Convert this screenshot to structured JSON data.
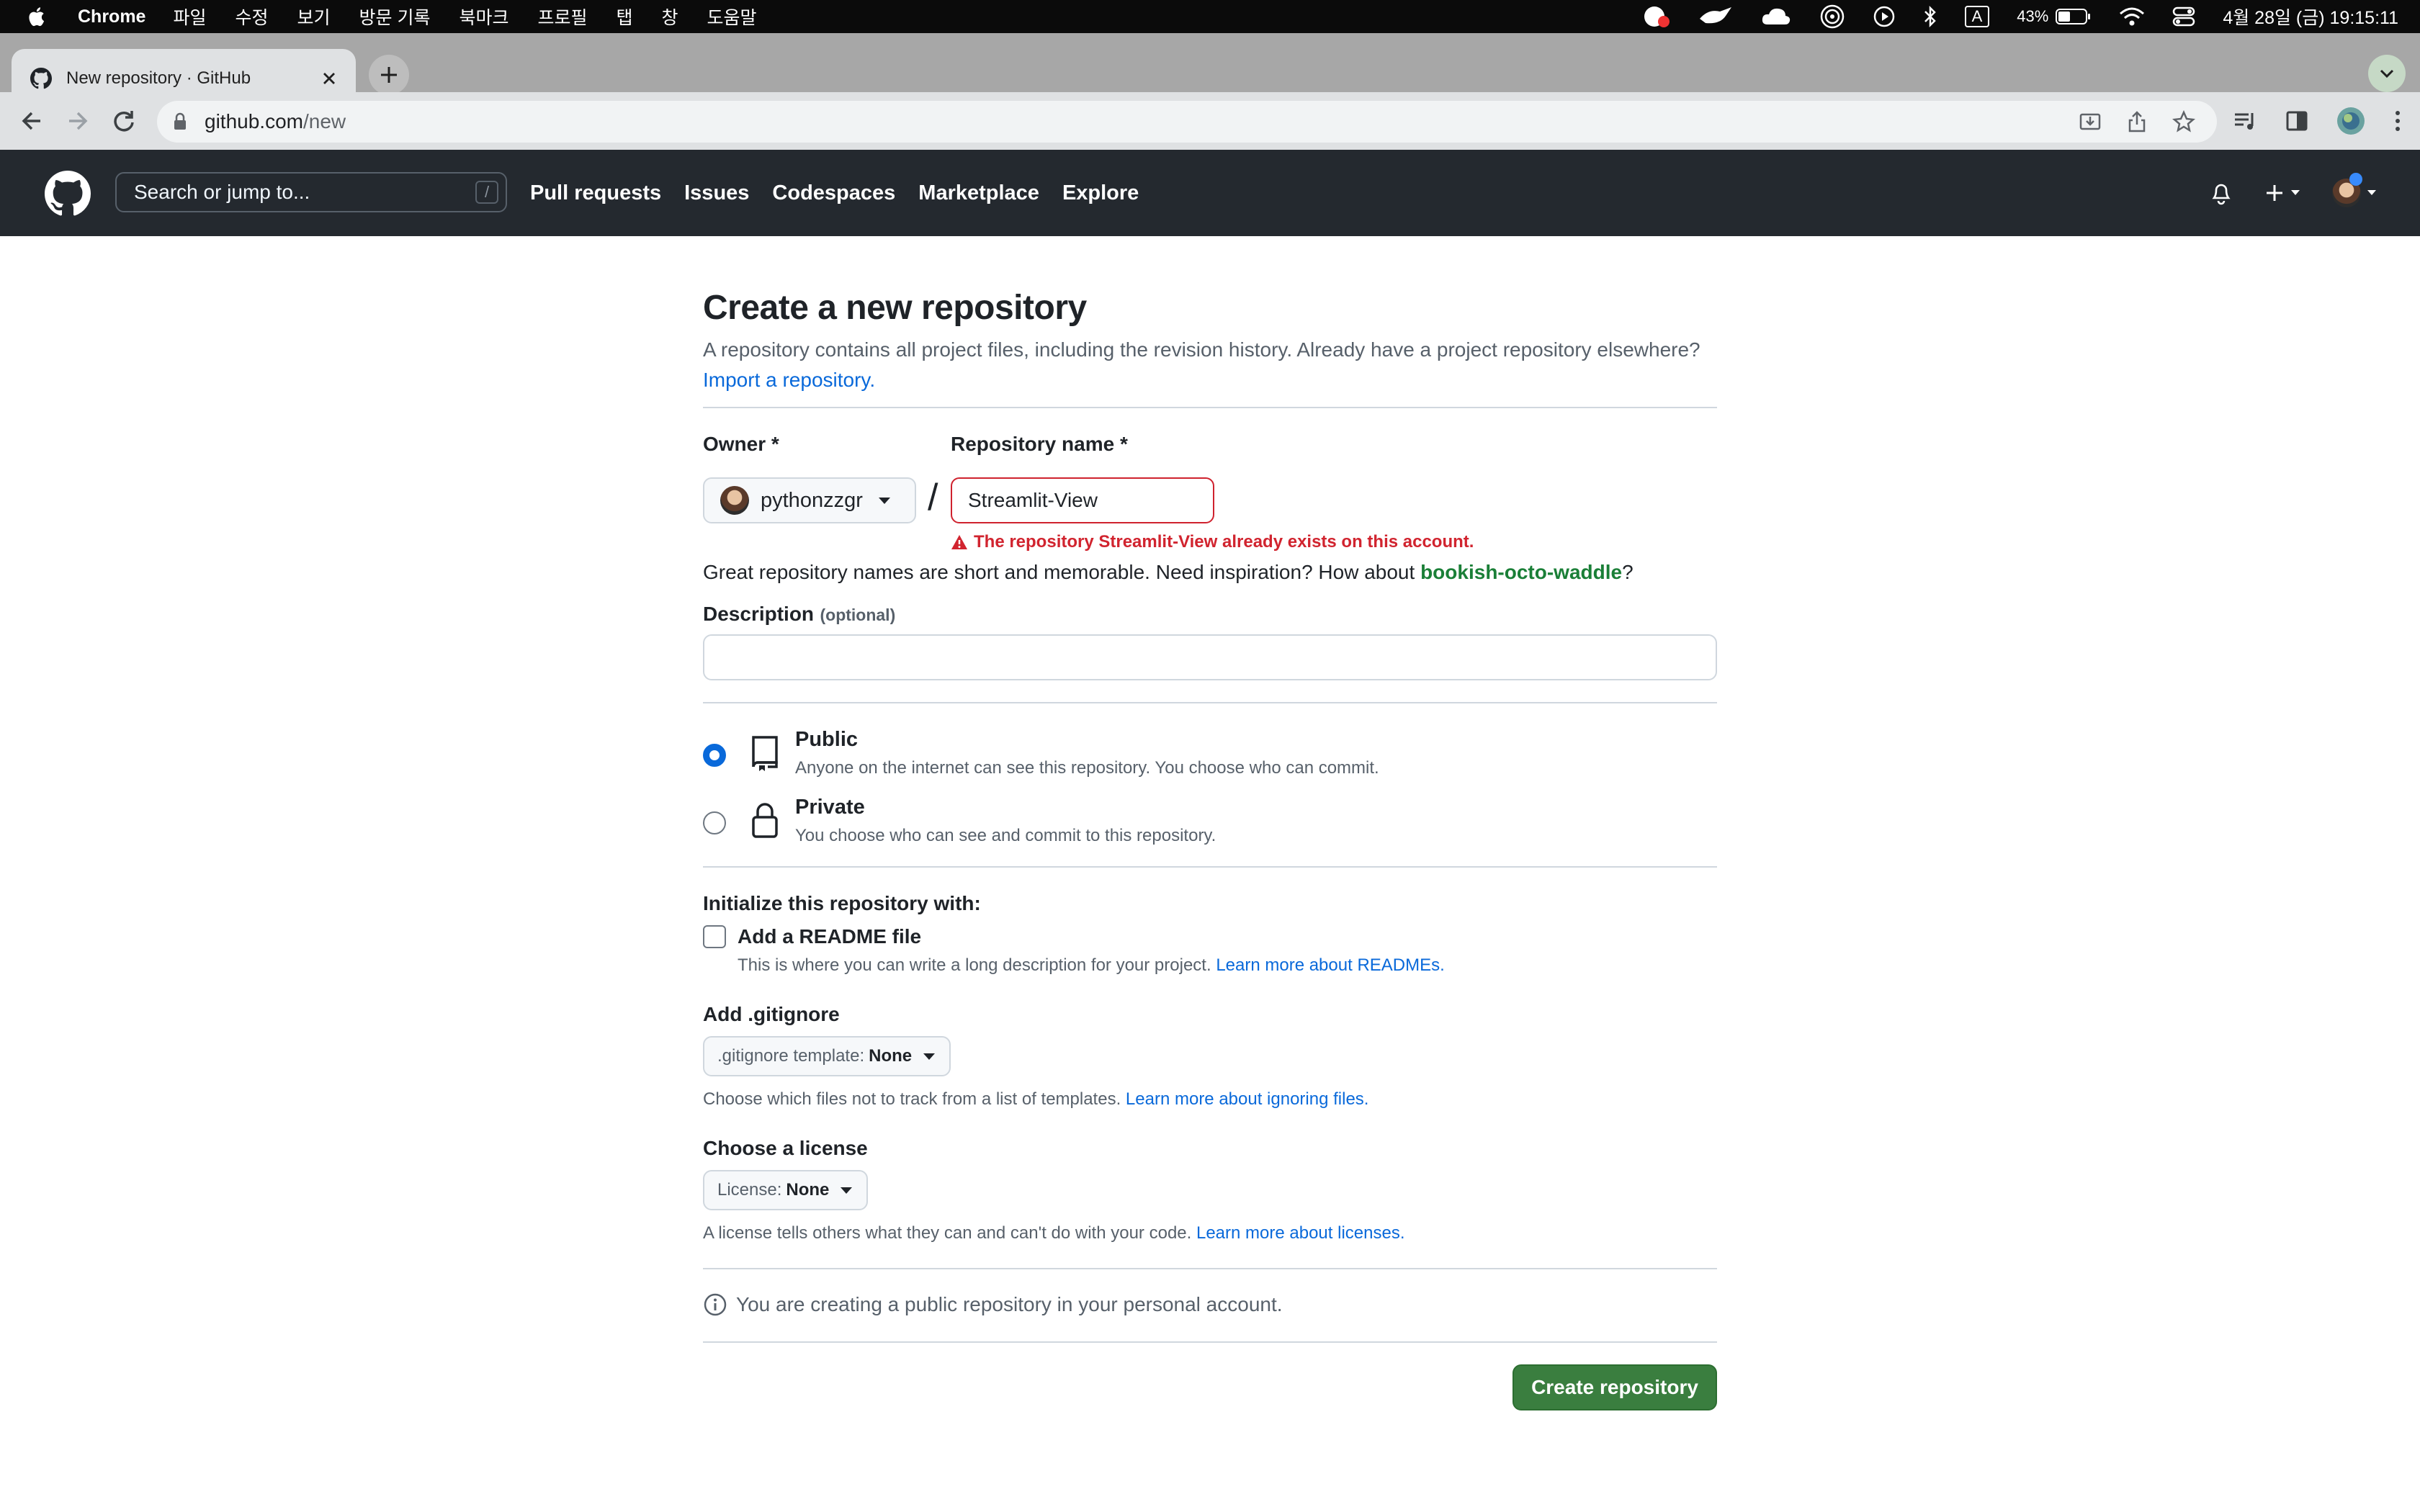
{
  "macos_menubar": {
    "app_name": "Chrome",
    "menus": [
      "파일",
      "수정",
      "보기",
      "방문 기록",
      "북마크",
      "프로필",
      "탭",
      "창",
      "도움말"
    ],
    "battery": "43%",
    "input_source": "A",
    "datetime": "4월 28일 (금) 19:15:11"
  },
  "browser": {
    "tab_title": "New repository · GitHub",
    "url_host": "github.com",
    "url_path": "/new"
  },
  "github_header": {
    "search_placeholder": "Search or jump to...",
    "search_shortcut": "/",
    "nav": [
      "Pull requests",
      "Issues",
      "Codespaces",
      "Marketplace",
      "Explore"
    ]
  },
  "page": {
    "title": "Create a new repository",
    "subtitle": "A repository contains all project files, including the revision history. Already have a project repository elsewhere?",
    "import_link": "Import a repository.",
    "owner_label": "Owner *",
    "owner_value": "pythonzzgr",
    "repo_name_label": "Repository name *",
    "repo_name_value": "Streamlit-View",
    "error_message": "The repository Streamlit-View already exists on this account.",
    "suggestion_prefix": "Great repository names are short and memorable. Need inspiration? How about",
    "suggestion_name": "bookish-octo-waddle",
    "suggestion_suffix": "?",
    "description_label": "Description",
    "description_optional": "(optional)",
    "description_value": "",
    "visibility": {
      "selected": "Public",
      "public_title": "Public",
      "public_desc": "Anyone on the internet can see this repository. You choose who can commit.",
      "private_title": "Private",
      "private_desc": "You choose who can see and commit to this repository."
    },
    "init_heading": "Initialize this repository with:",
    "readme_label": "Add a README file",
    "readme_desc": "This is where you can write a long description for your project.",
    "readme_link": "Learn more about READMEs.",
    "gitignore_heading": "Add .gitignore",
    "gitignore_select_prefix": ".gitignore template:",
    "gitignore_select_value": "None",
    "gitignore_note": "Choose which files not to track from a list of templates.",
    "gitignore_link": "Learn more about ignoring files.",
    "license_heading": "Choose a license",
    "license_select_prefix": "License:",
    "license_select_value": "None",
    "license_note": "A license tells others what they can and can't do with your code.",
    "license_link": "Learn more about licenses.",
    "info_note": "You are creating a public repository in your personal account.",
    "create_button": "Create repository"
  }
}
